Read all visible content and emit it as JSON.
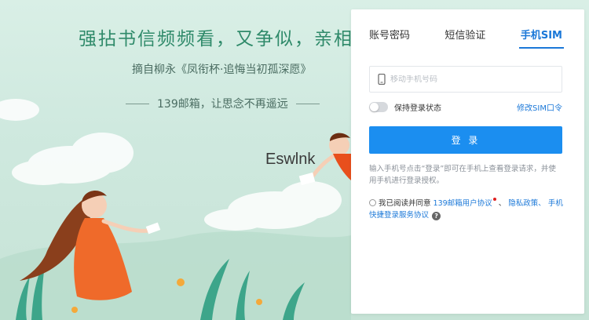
{
  "banner": {
    "headline": "强拈书信频频看，又争似，亲相",
    "attribution": "摘自柳永《凤衔杯·追悔当初孤深愿》",
    "slogan": "139邮箱，让思念不再遥远",
    "watermark": "Eswlnk"
  },
  "login": {
    "tabs": [
      {
        "label": "账号密码"
      },
      {
        "label": "短信验证"
      },
      {
        "label": "手机SIM",
        "active": true
      }
    ],
    "phone_input": {
      "value": "",
      "placeholder": "移动手机号码",
      "icon": "mobile-phone-icon"
    },
    "remember_label": "保持登录状态",
    "remember_on": false,
    "change_sim_link": "修改SIM口令",
    "login_button": "登 录",
    "hint": "输入手机号点击“登录”即可在手机上查看登录请求，并使用手机进行登录授权。",
    "agreement": {
      "prefix": "我已阅读并同意",
      "user_agreement": "139邮箱用户协议",
      "sep": "、",
      "privacy": "隐私政策、",
      "sim_terms": "手机快捷登录服务协议",
      "help_symbol": "?"
    }
  },
  "colors": {
    "accent": "#1b78d8",
    "button": "#1b8ef0",
    "headline": "#2f8a6a",
    "background": "#cfe9df"
  }
}
